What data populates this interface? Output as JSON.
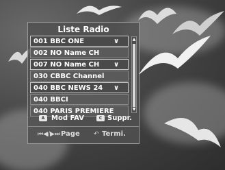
{
  "panel": {
    "title": "Liste Radio",
    "items": [
      {
        "label": "001 BBC ONE",
        "has_chevron": true
      },
      {
        "label": "002 NO Name CH",
        "has_chevron": false
      },
      {
        "label": "007 NO Name CH",
        "has_chevron": true
      },
      {
        "label": "030 CBBC Channel",
        "has_chevron": false
      },
      {
        "label": "040 BBC NEWS 24",
        "has_chevron": true
      },
      {
        "label": "040 BBCI",
        "has_chevron": false
      },
      {
        "label": "040 PARIS PREMIERE",
        "has_chevron": false
      }
    ],
    "actions": {
      "a_key": "A",
      "mod_fav": "Mod FAV",
      "c_key": "C",
      "suppr": "Suppr."
    },
    "footer": {
      "page_icon": "⏮◀/▶⏭",
      "page": "Page",
      "return_icon": "↶",
      "termi": "Termi."
    }
  },
  "icons": {
    "chevron": "chevron-down-icon",
    "scroll_up": "scroll-up-arrow-icon",
    "scroll_down": "scroll-down-arrow-icon"
  },
  "colors": {
    "panel_bg": "#505050",
    "text": "#ffffff",
    "border": "#8a8a8a"
  }
}
